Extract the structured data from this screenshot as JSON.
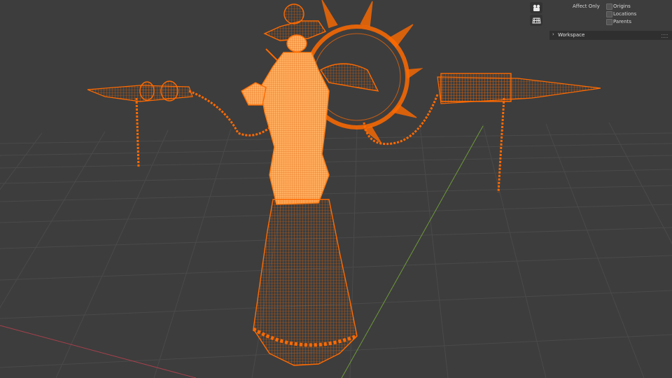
{
  "viewport": {
    "model_color": "#ff6a00",
    "grid_color": "#4a4a4a",
    "x_axis_color": "#a6404c",
    "y_axis_color": "#6f9a39"
  },
  "gizmo": {
    "camera_icon": "camera-icon",
    "grid_icon": "grid-icon"
  },
  "options_panel": {
    "affect_only_label": "Affect Only",
    "origins_label": "Origins",
    "locations_label": "Locations",
    "parents_label": "Parents",
    "workspace_label": "Workspace"
  }
}
